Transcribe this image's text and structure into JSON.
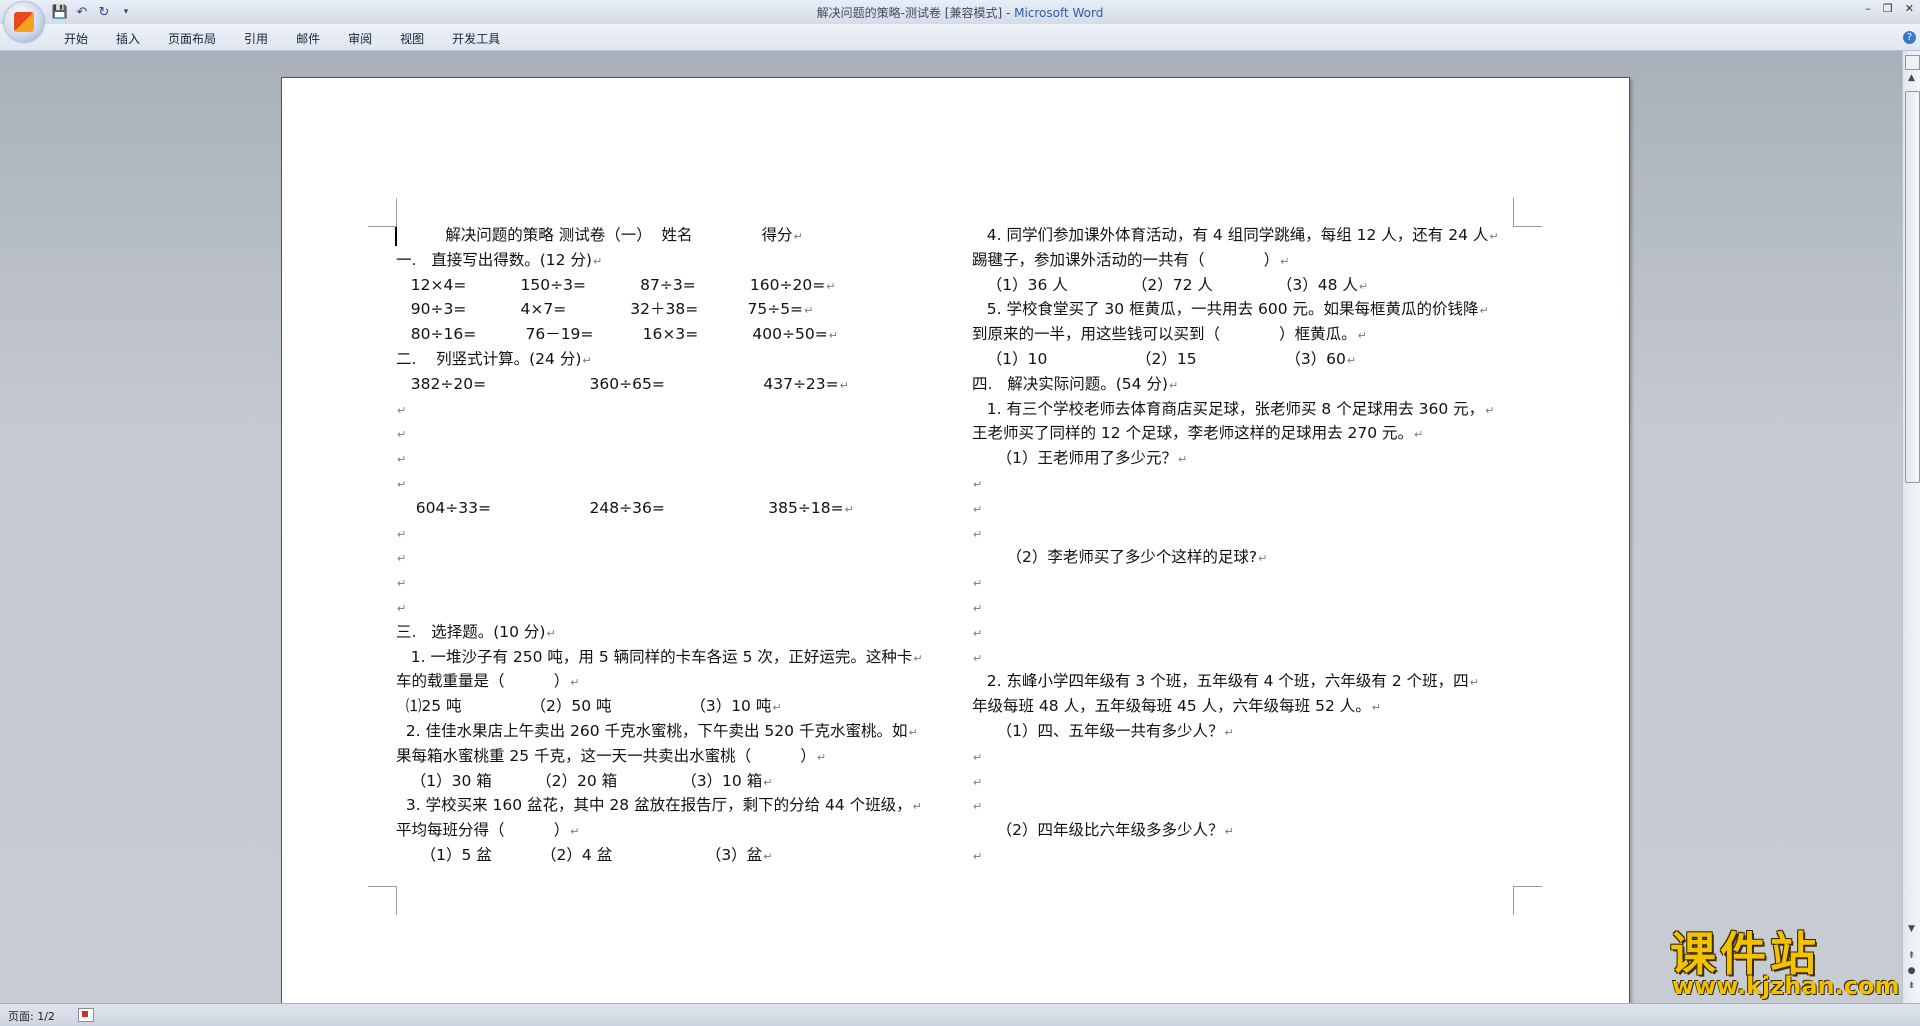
{
  "window": {
    "title_doc": "解决问题的策略-测试卷 [兼容模式] - ",
    "title_app": "Microsoft Word",
    "controls": [
      "–",
      "❐",
      "✕"
    ]
  },
  "qat": {
    "save": "💾",
    "undo": "↶",
    "redo": "↻",
    "more": "▾"
  },
  "ribbon": {
    "tabs": [
      "开始",
      "插入",
      "页面布局",
      "引用",
      "邮件",
      "审阅",
      "视图",
      "开发工具"
    ],
    "help": "?"
  },
  "document": {
    "left_column": [
      "          解决问题的策略 测试卷（一）  姓名              得分",
      "一.   直接写出得数。(12 分)",
      "   12×4=           150÷3=           87÷3=           160÷20=",
      "   90÷3=           4×7=             32＋38=          75÷5=",
      "   80÷16=          76－19=          16×3=           400÷50=",
      "二.    列竖式计算。(24 分)",
      "   382÷20=                     360÷65=                    437÷23=",
      "",
      "",
      "",
      "",
      "    604÷33=                    248÷36=                     385÷18=",
      "",
      "",
      "",
      "",
      "三.   选择题。(10 分)",
      "   1. 一堆沙子有 250 吨，用 5 辆同样的卡车各运 5 次，正好运完。这种卡",
      "车的载重量是（          ）",
      "  ⑴25 吨              （2）50 吨                （3）10 吨",
      "  2. 佳佳水果店上午卖出 260 千克水蜜桃，下午卖出 520 千克水蜜桃。如",
      "果每箱水蜜桃重 25 千克，这一天一共卖出水蜜桃（          ）",
      "   （1）30 箱         （2）20 箱             （3）10 箱",
      "  3. 学校买来 160 盆花，其中 28 盆放在报告厅，剩下的分给 44 个班级，",
      "平均每班分得（          ）",
      "     （1）5 盆          （2）4 盆                   （3）盆"
    ],
    "right_column": [
      "   4. 同学们参加课外体育活动，有 4 组同学跳绳，每组 12 人，还有 24 人",
      "踢毽子，参加课外活动的一共有（            ）",
      "   （1）36 人             （2）72 人             （3）48 人",
      "   5. 学校食堂买了 30 框黄瓜，一共用去 600 元。如果每框黄瓜的价钱降",
      "到原来的一半，用这些钱可以买到（            ）框黄瓜。",
      "   （1）10                  （2）15                  （3）60",
      "四.   解决实际问题。(54 分)",
      "   1. 有三个学校老师去体育商店买足球，张老师买 8 个足球用去 360 元，",
      "王老师买了同样的 12 个足球，李老师这样的足球用去 270 元。",
      "     （1）王老师用了多少元？",
      "",
      "",
      "",
      "       （2）李老师买了多少个这样的足球?",
      "",
      "",
      "",
      "",
      "   2. 东峰小学四年级有 3 个班，五年级有 4 个班，六年级有 2 个班，四",
      "年级每班 48 人，五年级每班 45 人，六年级每班 52 人。",
      "     （1）四、五年级一共有多少人？",
      "",
      "",
      "",
      "     （2）四年级比六年级多多少人？",
      ""
    ],
    "paragraph_mark": "↵"
  },
  "statusbar": {
    "page": "页面: 1/2"
  },
  "watermark": {
    "main": "课件站",
    "url": "www.kjzhan.com"
  }
}
